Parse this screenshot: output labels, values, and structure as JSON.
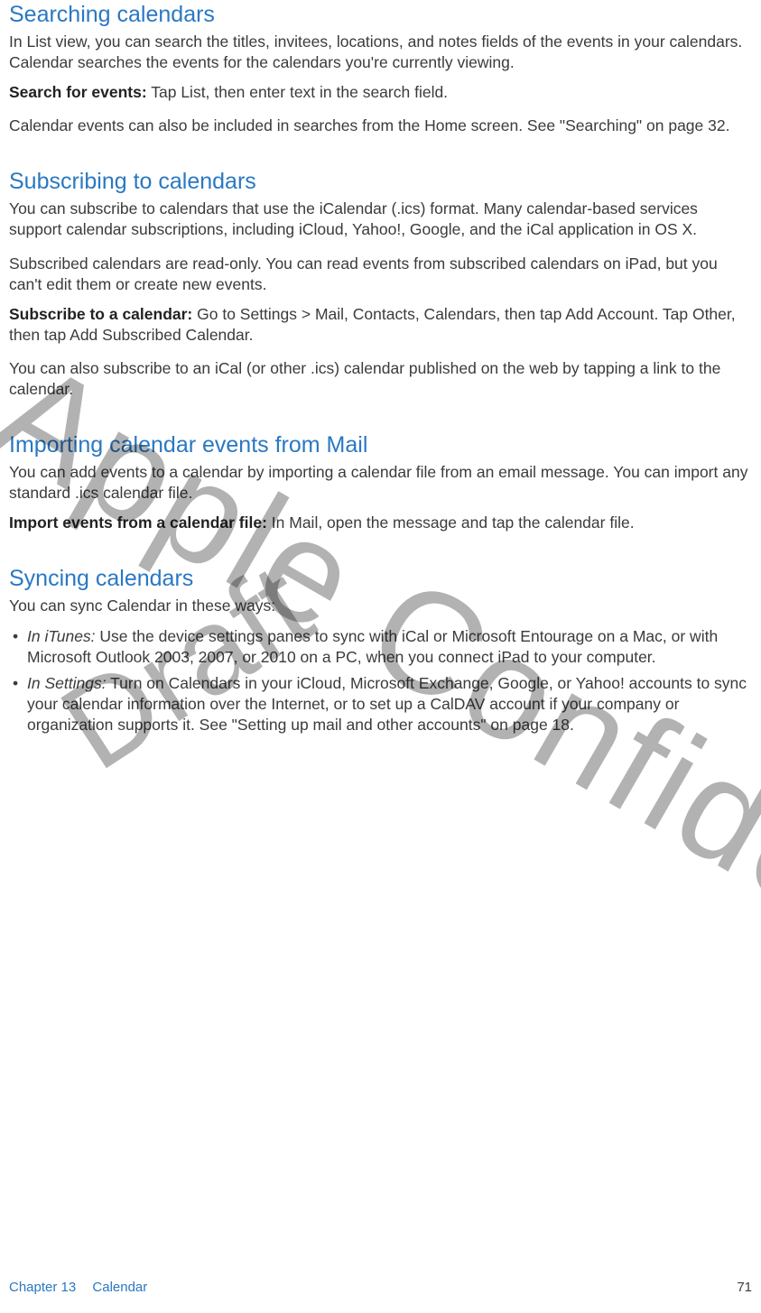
{
  "sections": [
    {
      "heading": "Searching calendars",
      "p1": "In List view, you can search the titles, invitees, locations, and notes fields of the events in your calendars. Calendar searches the events for the calendars you're currently viewing.",
      "step_label": "Search for events:",
      "step_text": " Tap List, then enter text in the search field.",
      "p2": "Calendar events can also be included in searches from the Home screen. See \"Searching\" on page 32."
    },
    {
      "heading": "Subscribing to calendars",
      "p1": "You can subscribe to calendars that use the iCalendar (.ics) format. Many calendar-based services support calendar subscriptions, including iCloud, Yahoo!, Google, and the iCal application in OS X.",
      "p2": "Subscribed calendars are read-only. You can read events from subscribed calendars on iPad, but you can't edit them or create new events.",
      "step_label": "Subscribe to a calendar:",
      "step_text": " Go to Settings > Mail, Contacts, Calendars, then tap Add Account. Tap Other, then tap Add Subscribed Calendar.",
      "p3": "You can also subscribe to an iCal (or other .ics) calendar published on the web by tapping a link to the calendar."
    },
    {
      "heading": "Importing calendar events from Mail",
      "p1": "You can add events to a calendar by importing a calendar file from an email message. You can import any standard .ics calendar file.",
      "step_label": "Import events from a calendar file:",
      "step_text": " In Mail, open the message and tap the calendar file."
    },
    {
      "heading": "Syncing calendars",
      "p1": "You can sync Calendar in these ways:",
      "bullets": [
        {
          "label": "In iTunes:",
          "text": " Use the device settings panes to sync with iCal or Microsoft Entourage on a Mac, or with Microsoft Outlook 2003, 2007, or 2010 on a PC, when you connect iPad to your computer."
        },
        {
          "label": "In Settings:",
          "text": " Turn on Calendars in your iCloud, Microsoft Exchange, Google, or Yahoo! accounts to sync your calendar information over the Internet, or to set up a CalDAV account if your company or organization supports it. See \"Setting up mail and other accounts\" on page 18."
        }
      ]
    }
  ],
  "watermarks": {
    "draft": "Draft",
    "confidential": "Apple Confidential"
  },
  "footer": {
    "chapter_label": "Chapter 13",
    "chapter_name": "Calendar",
    "page_number": "71"
  }
}
